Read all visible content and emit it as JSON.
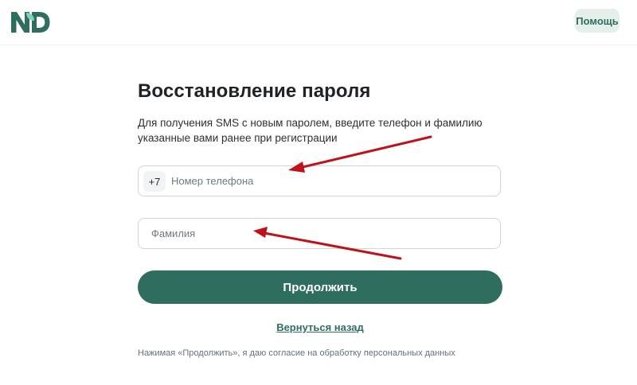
{
  "header": {
    "logo_text": "ND",
    "help_label": "Помощь"
  },
  "form": {
    "title": "Восстановление пароля",
    "subtitle": "Для получения SMS с новым паролем, введите телефон и фамилию указанные вами ранее при регистрации",
    "phone": {
      "prefix": "+7",
      "placeholder": "Номер телефона",
      "value": ""
    },
    "surname": {
      "placeholder": "Фамилия",
      "value": ""
    },
    "submit_label": "Продолжить",
    "back_label": "Вернуться назад",
    "consent_text": "Нажимая «Продолжить», я даю согласие на обработку персональных данных"
  },
  "colors": {
    "brand": "#2f6e5f",
    "help_bg": "#e4efe9",
    "annotation_arrow": "#c0121a"
  },
  "icons": {
    "logo": "nd-logo-icon",
    "annotations": [
      "arrow-to-phone-icon",
      "arrow-to-surname-icon"
    ]
  }
}
